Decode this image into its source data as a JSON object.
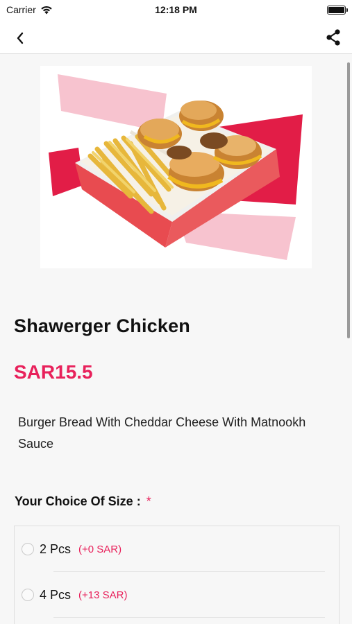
{
  "status_bar": {
    "carrier": "Carrier",
    "time": "12:18 PM"
  },
  "nav": {
    "back_icon": "chevron-left-icon",
    "share_icon": "share-icon"
  },
  "product": {
    "image_alt": "shawerger box",
    "name": "Shawerger Chicken",
    "price": "SAR15.5",
    "description": "Burger Bread With Cheddar Cheese With Matnookh Sauce"
  },
  "size_section": {
    "label": "Your Choice Of Size :",
    "required_marker": "*",
    "options": [
      {
        "label": "2 Pcs",
        "extra": "(+0 SAR)"
      },
      {
        "label": "4 Pcs",
        "extra": "(+13 SAR)"
      }
    ]
  },
  "colors": {
    "accent": "#e8215b",
    "background": "#f7f7f7"
  }
}
